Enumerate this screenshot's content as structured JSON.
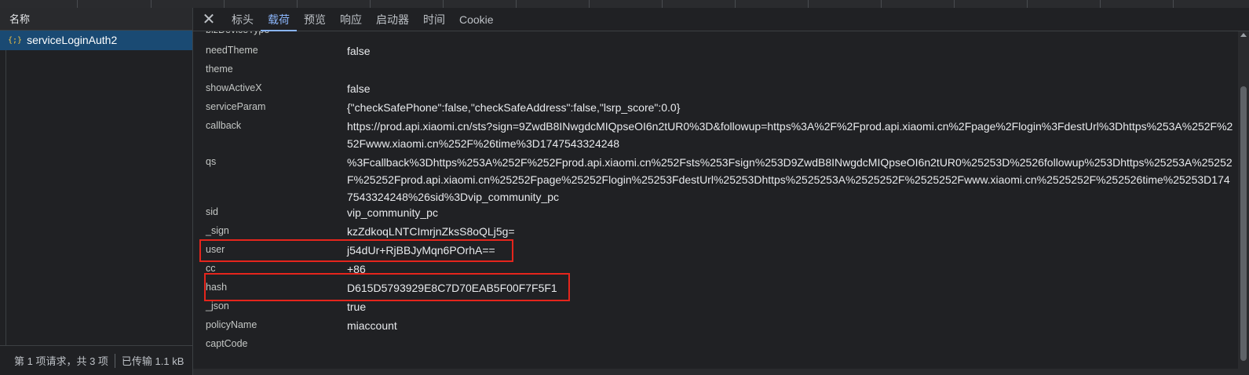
{
  "requests": {
    "column_header": "名称",
    "items": [
      {
        "name": "serviceLoginAuth2",
        "icon": "json-file-icon",
        "selected": true
      }
    ]
  },
  "status_bar": {
    "request_count": "第 1 项请求，共 3 项",
    "transferred": "已传输 1.1 kB"
  },
  "detail_tabs": [
    {
      "label": "标头",
      "active": false
    },
    {
      "label": "载荷",
      "active": true
    },
    {
      "label": "预览",
      "active": false
    },
    {
      "label": "响应",
      "active": false
    },
    {
      "label": "启动器",
      "active": false
    },
    {
      "label": "时间",
      "active": false
    },
    {
      "label": "Cookie",
      "active": false
    }
  ],
  "payload": [
    {
      "key": "needTheme",
      "value": "false"
    },
    {
      "key": "theme",
      "value": ""
    },
    {
      "key": "showActiveX",
      "value": "false"
    },
    {
      "key": "serviceParam",
      "value": "{\"checkSafePhone\":false,\"checkSafeAddress\":false,\"lsrp_score\":0.0}"
    },
    {
      "key": "callback",
      "value": "https://prod.api.xiaomi.cn/sts?sign=9ZwdB8INwgdcMIQpseOI6n2tUR0%3D&followup=https%3A%2F%2Fprod.api.xiaomi.cn%2Fpage%2Flogin%3FdestUrl%3Dhttps%253A%252F%252Fwww.xiaomi.cn%252F%26time%3D1747543324248"
    },
    {
      "key": "qs",
      "value": "%3Fcallback%3Dhttps%253A%252F%252Fprod.api.xiaomi.cn%252Fsts%253Fsign%253D9ZwdB8INwgdcMIQpseOI6n2tUR0%25253D%2526followup%253Dhttps%25253A%25252F%25252Fprod.api.xiaomi.cn%25252Fpage%25252Flogin%25253FdestUrl%25253Dhttps%2525253A%2525252F%2525252Fwww.xiaomi.cn%2525252F%252526time%25253D1747543324248%26sid%3Dvip_community_pc"
    },
    {
      "key": "sid",
      "value": "vip_community_pc"
    },
    {
      "key": "_sign",
      "value": "kzZdkoqLNTCImrjnZksS8oQLj5g="
    },
    {
      "key": "user",
      "value": "j54dUr+RjBBJyMqn6POrhA=="
    },
    {
      "key": "cc",
      "value": "+86"
    },
    {
      "key": "hash",
      "value": "D615D5793929E8C7D70EAB5F00F7F5F1"
    },
    {
      "key": "_json",
      "value": "true"
    },
    {
      "key": "policyName",
      "value": "miaccount"
    },
    {
      "key": "captCode",
      "value": ""
    }
  ],
  "partial_top_key": "bizDeviceType",
  "colors": {
    "selection": "#1a4a73",
    "active_tab": "#8ab4f8",
    "highlight_box": "#e5251c"
  }
}
